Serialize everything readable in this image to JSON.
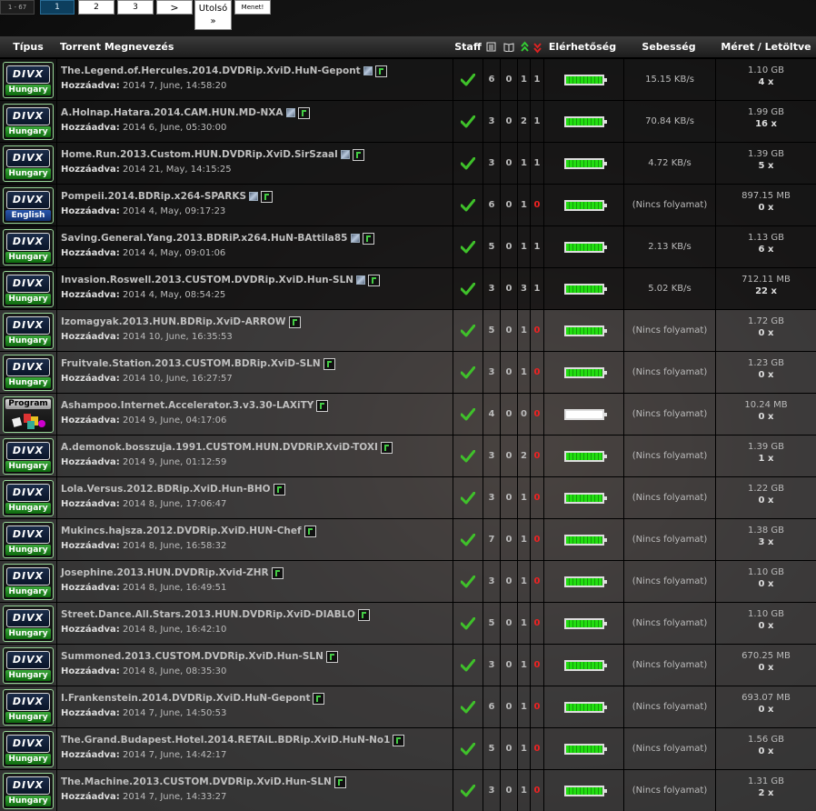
{
  "pager": {
    "range": "1 - 67",
    "pages": [
      "1",
      "2",
      "3"
    ],
    "next": ">",
    "last": "Utolsó",
    "last_arrows": "»",
    "go": "Menet!"
  },
  "headers": {
    "type": "Típus",
    "name": "Torrent Megnevezés",
    "staff": "Staff",
    "availability": "Elérhetőség",
    "speed": "Sebesség",
    "size": "Méret / Letöltve"
  },
  "added_label": "Hozzáadva:",
  "colors": {
    "header_bg": "#2a2a2a",
    "bar_green": "#22dd11",
    "seed_zero": "#ee2222",
    "badge_green": "#0e6a0e"
  },
  "rows": [
    {
      "badge": "DIVX",
      "lang": "Hungary",
      "name": "The.Legend.of.Hercules.2014.DVDRip.XviD.HuN-Gepont",
      "hu": true,
      "added": "2014 7, June, 14:58:20",
      "n": [
        "6",
        "0",
        "1",
        "1"
      ],
      "bar": 1,
      "speed": "15.15 KB/s",
      "size": "1.10 GB",
      "dl": "4 x"
    },
    {
      "badge": "DIVX",
      "lang": "Hungary",
      "name": "A.Holnap.Hatara.2014.CAM.HUN.MD-NXA",
      "hu": true,
      "added": "2014 6, June, 05:30:00",
      "n": [
        "3",
        "0",
        "2",
        "1"
      ],
      "bar": 1,
      "speed": "70.84 KB/s",
      "size": "1.99 GB",
      "dl": "16 x"
    },
    {
      "badge": "DIVX",
      "lang": "Hungary",
      "name": "Home.Run.2013.Custom.HUN.DVDRip.XviD.SirSzaal",
      "hu": true,
      "added": "2014 21, May, 14:15:25",
      "n": [
        "3",
        "0",
        "1",
        "1"
      ],
      "bar": 1,
      "speed": "4.72 KB/s",
      "size": "1.39 GB",
      "dl": "5 x"
    },
    {
      "badge": "DIVX",
      "lang": "English",
      "name": "Pompeii.2014.BDRip.x264-SPARKS",
      "hu": true,
      "added": "2014 4, May, 09:17:23",
      "n": [
        "6",
        "0",
        "1",
        "0"
      ],
      "bar": 1,
      "speed": "(Nincs folyamat)",
      "size": "897.15 MB",
      "dl": "0 x"
    },
    {
      "badge": "DIVX",
      "lang": "Hungary",
      "name": "Saving.General.Yang.2013.BDRiP.x264.HuN-BAttila85",
      "hu": true,
      "added": "2014 4, May, 09:01:06",
      "n": [
        "5",
        "0",
        "1",
        "1"
      ],
      "bar": 1,
      "speed": "2.13 KB/s",
      "size": "1.13 GB",
      "dl": "6 x"
    },
    {
      "badge": "DIVX",
      "lang": "Hungary",
      "name": "Invasion.Roswell.2013.CUSTOM.DVDRip.XviD.Hun-SLN",
      "hu": true,
      "added": "2014 4, May, 08:54:25",
      "n": [
        "3",
        "0",
        "3",
        "1"
      ],
      "bar": 1,
      "speed": "5.02 KB/s",
      "size": "712.11 MB",
      "dl": "22 x"
    },
    {
      "badge": "DIVX",
      "lang": "Hungary",
      "name": "Izomagyak.2013.HUN.BDRip.XviD-ARROW",
      "hu": false,
      "added": "2014 10, June, 16:35:53",
      "n": [
        "5",
        "0",
        "1",
        "0"
      ],
      "bar": 1,
      "speed": "(Nincs folyamat)",
      "size": "1.72 GB",
      "dl": "0 x"
    },
    {
      "badge": "DIVX",
      "lang": "Hungary",
      "name": "Fruitvale.Station.2013.CUSTOM.BDRip.XviD-SLN",
      "hu": false,
      "added": "2014 10, June, 16:27:57",
      "n": [
        "3",
        "0",
        "1",
        "0"
      ],
      "bar": 1,
      "speed": "(Nincs folyamat)",
      "size": "1.23 GB",
      "dl": "0 x"
    },
    {
      "badge": "PROGRAM",
      "lang": "Program",
      "name": "Ashampoo.Internet.Accelerator.3.v3.30-LAXiTY",
      "hu": false,
      "added": "2014 9, June, 04:17:06",
      "n": [
        "4",
        "0",
        "0",
        "0"
      ],
      "bar": 0,
      "speed": "(Nincs folyamat)",
      "size": "10.24 MB",
      "dl": "0 x"
    },
    {
      "badge": "DIVX",
      "lang": "Hungary",
      "name": "A.demonok.bosszuja.1991.CUSTOM.HUN.DVDRiP.XviD-TOXI",
      "hu": false,
      "added": "2014 9, June, 01:12:59",
      "n": [
        "3",
        "0",
        "2",
        "0"
      ],
      "bar": 1,
      "speed": "(Nincs folyamat)",
      "size": "1.39 GB",
      "dl": "1 x"
    },
    {
      "badge": "DIVX",
      "lang": "Hungary",
      "name": "Lola.Versus.2012.BDRip.XviD.Hun-BHO",
      "hu": false,
      "added": "2014 8, June, 17:06:47",
      "n": [
        "3",
        "0",
        "1",
        "0"
      ],
      "bar": 1,
      "speed": "(Nincs folyamat)",
      "size": "1.22 GB",
      "dl": "0 x"
    },
    {
      "badge": "DIVX",
      "lang": "Hungary",
      "name": "Mukincs.hajsza.2012.DVDRip.XviD.HUN-Chef",
      "hu": false,
      "added": "2014 8, June, 16:58:32",
      "n": [
        "7",
        "0",
        "1",
        "0"
      ],
      "bar": 1,
      "speed": "(Nincs folyamat)",
      "size": "1.38 GB",
      "dl": "3 x"
    },
    {
      "badge": "DIVX",
      "lang": "Hungary",
      "name": "Josephine.2013.HUN.DVDRip.Xvid-ZHR",
      "hu": false,
      "added": "2014 8, June, 16:49:51",
      "n": [
        "3",
        "0",
        "1",
        "0"
      ],
      "bar": 1,
      "speed": "(Nincs folyamat)",
      "size": "1.10 GB",
      "dl": "0 x"
    },
    {
      "badge": "DIVX",
      "lang": "Hungary",
      "name": "Street.Dance.All.Stars.2013.HUN.DVDRip.XviD-DIABLO",
      "hu": false,
      "added": "2014 8, June, 16:42:10",
      "n": [
        "5",
        "0",
        "1",
        "0"
      ],
      "bar": 1,
      "speed": "(Nincs folyamat)",
      "size": "1.10 GB",
      "dl": "0 x"
    },
    {
      "badge": "DIVX",
      "lang": "Hungary",
      "name": "Summoned.2013.CUSTOM.DVDRip.XviD.Hun-SLN",
      "hu": false,
      "added": "2014 8, June, 08:35:30",
      "n": [
        "3",
        "0",
        "1",
        "0"
      ],
      "bar": 1,
      "speed": "(Nincs folyamat)",
      "size": "670.25 MB",
      "dl": "0 x"
    },
    {
      "badge": "DIVX",
      "lang": "Hungary",
      "name": "I.Frankenstein.2014.DVDRip.XviD.HuN-Gepont",
      "hu": false,
      "added": "2014 7, June, 14:50:53",
      "n": [
        "6",
        "0",
        "1",
        "0"
      ],
      "bar": 1,
      "speed": "(Nincs folyamat)",
      "size": "693.07 MB",
      "dl": "0 x"
    },
    {
      "badge": "DIVX",
      "lang": "Hungary",
      "name": "The.Grand.Budapest.Hotel.2014.RETAiL.BDRip.XviD.HuN-No1",
      "hu": false,
      "added": "2014 7, June, 14:42:17",
      "n": [
        "5",
        "0",
        "1",
        "0"
      ],
      "bar": 1,
      "speed": "(Nincs folyamat)",
      "size": "1.56 GB",
      "dl": "0 x"
    },
    {
      "badge": "DIVX",
      "lang": "Hungary",
      "name": "The.Machine.2013.CUSTOM.DVDRip.XviD.Hun-SLN",
      "hu": false,
      "added": "2014 7, June, 14:33:27",
      "n": [
        "3",
        "0",
        "1",
        "0"
      ],
      "bar": 1,
      "speed": "(Nincs folyamat)",
      "size": "1.31 GB",
      "dl": "2 x"
    }
  ]
}
